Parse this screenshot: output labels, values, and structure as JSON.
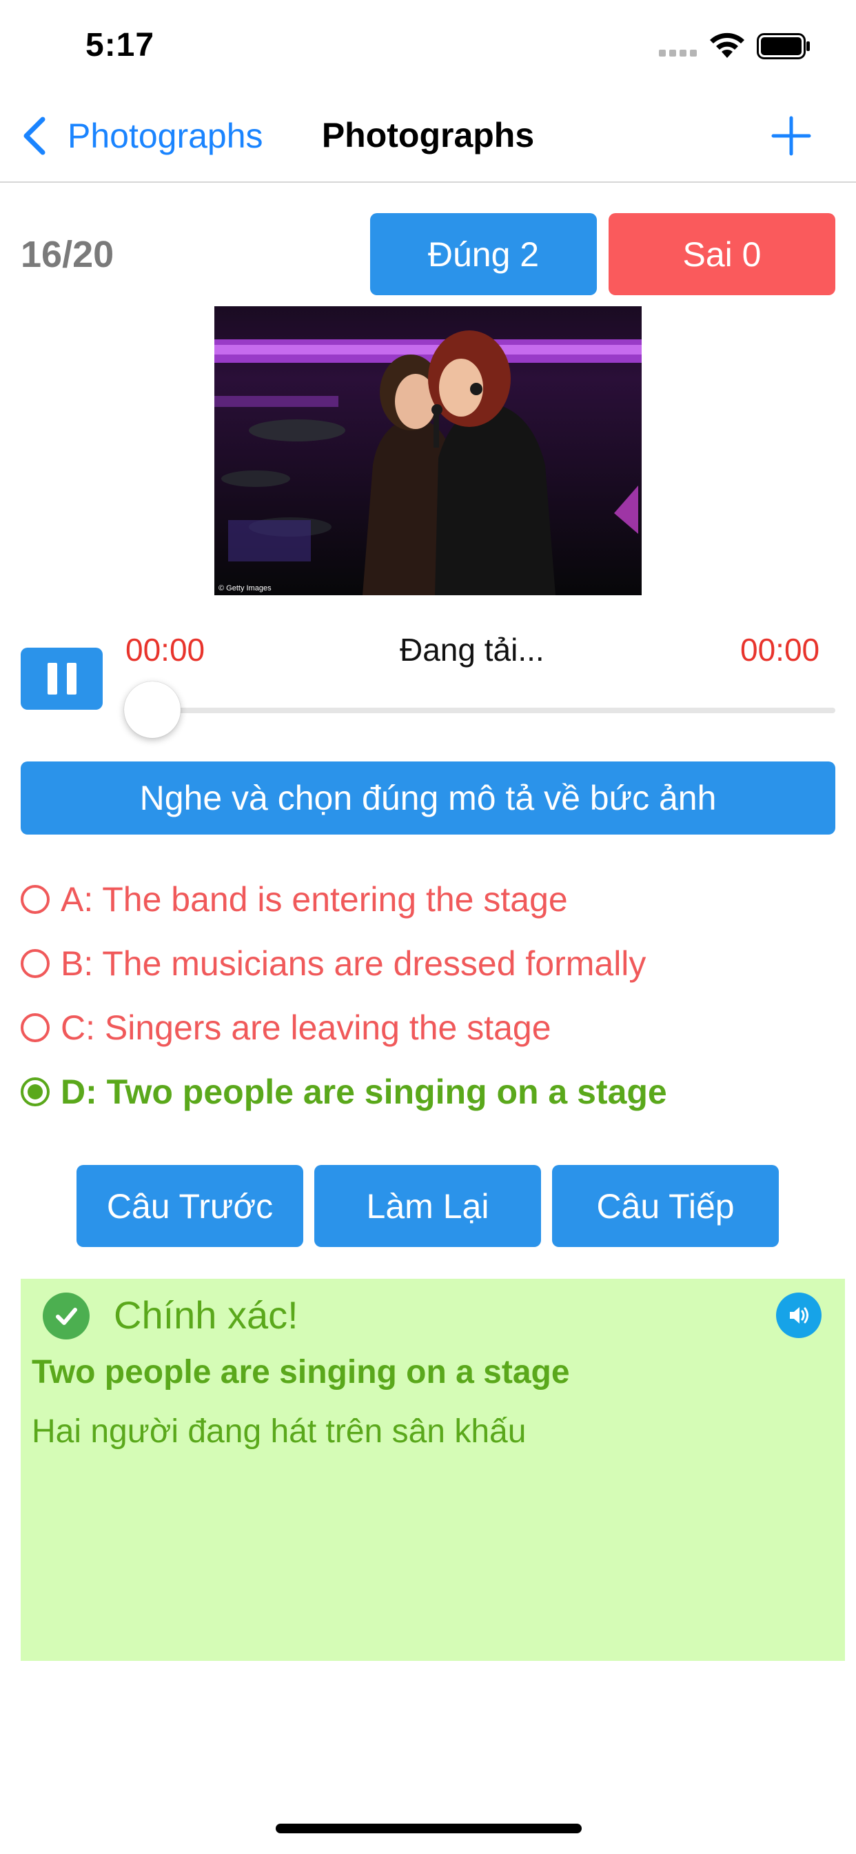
{
  "status_bar": {
    "time": "5:17"
  },
  "nav": {
    "back_label": "Photographs",
    "title": "Photographs",
    "add_icon": "plus-icon"
  },
  "score": {
    "progress": "16/20",
    "correct_label": "Đúng 2",
    "wrong_label": "Sai 0"
  },
  "photo": {
    "watermark": "© Getty Images"
  },
  "audio": {
    "current_time": "00:00",
    "status": "Đang tải...",
    "total_time": "00:00",
    "progress": 0
  },
  "instruction": "Nghe và chọn đúng mô tả về bức ảnh",
  "options": [
    {
      "text": "A: The band is entering the stage",
      "selected": false
    },
    {
      "text": "B: The musicians are dressed formally",
      "selected": false
    },
    {
      "text": "C: Singers are leaving the stage",
      "selected": false
    },
    {
      "text": "D: Two people are singing on a stage",
      "selected": true
    }
  ],
  "buttons": {
    "prev": "Câu Trước",
    "redo": "Làm Lại",
    "next": "Câu Tiếp"
  },
  "result": {
    "title": "Chính xác!",
    "english": "Two people are singing on a stage",
    "vietnamese": "Hai người đang hát trên sân khấu"
  },
  "colors": {
    "accent": "#2b93ea",
    "wrong": "#fa5a5c",
    "correct_green": "#5aa81b",
    "result_bg": "#d5fcb6",
    "link_blue": "#1a84ff"
  }
}
